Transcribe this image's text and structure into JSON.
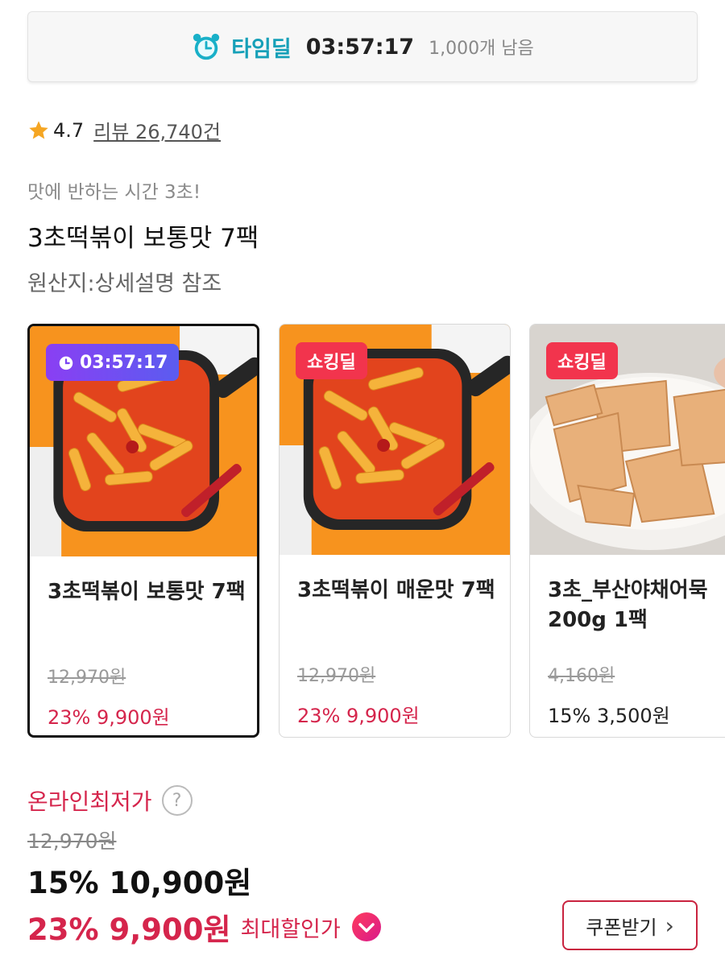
{
  "timedeal": {
    "label": "타임딜",
    "timer": "03:57:17",
    "stock": "1,000개 남음",
    "accent": "#16a0b8"
  },
  "rating": {
    "score": "4.7",
    "review": "리뷰 26,740건"
  },
  "product": {
    "subtitle": "맛에 반하는 시간 3초!",
    "title": "3초떡볶이 보통맛 7팩",
    "origin": "원산지:상세설명 참조"
  },
  "carousel": [
    {
      "badge": "03:57:17",
      "badge_type": "timer",
      "name": "3초떡볶이 보통맛 7팩",
      "orig_price": "12,970원",
      "sale": "23% 9,900원",
      "image": "tteokbokki-pan-photo"
    },
    {
      "badge": "쇼킹딜",
      "badge_type": "shock",
      "name": "3초떡볶이 매운맛 7팩",
      "orig_price": "12,970원",
      "sale": "23% 9,900원",
      "image": "tteokbokki-pan-photo"
    },
    {
      "badge": "쇼킹딜",
      "badge_type": "shock",
      "name": "3초_부산야채어묵 200g 1팩",
      "orig_price": "4,160원",
      "sale": "15% 3,500원",
      "image": "fishcake-bowl-photo"
    }
  ],
  "pricing": {
    "lowest_label": "온라인최저가",
    "help_icon": "?",
    "orig_price": "12,970원",
    "main_price": "15% 10,900원",
    "best_price": "23% 9,900원",
    "best_label": "최대할인가",
    "coupon_button": "쿠폰받기",
    "accent": "#d5254c"
  }
}
